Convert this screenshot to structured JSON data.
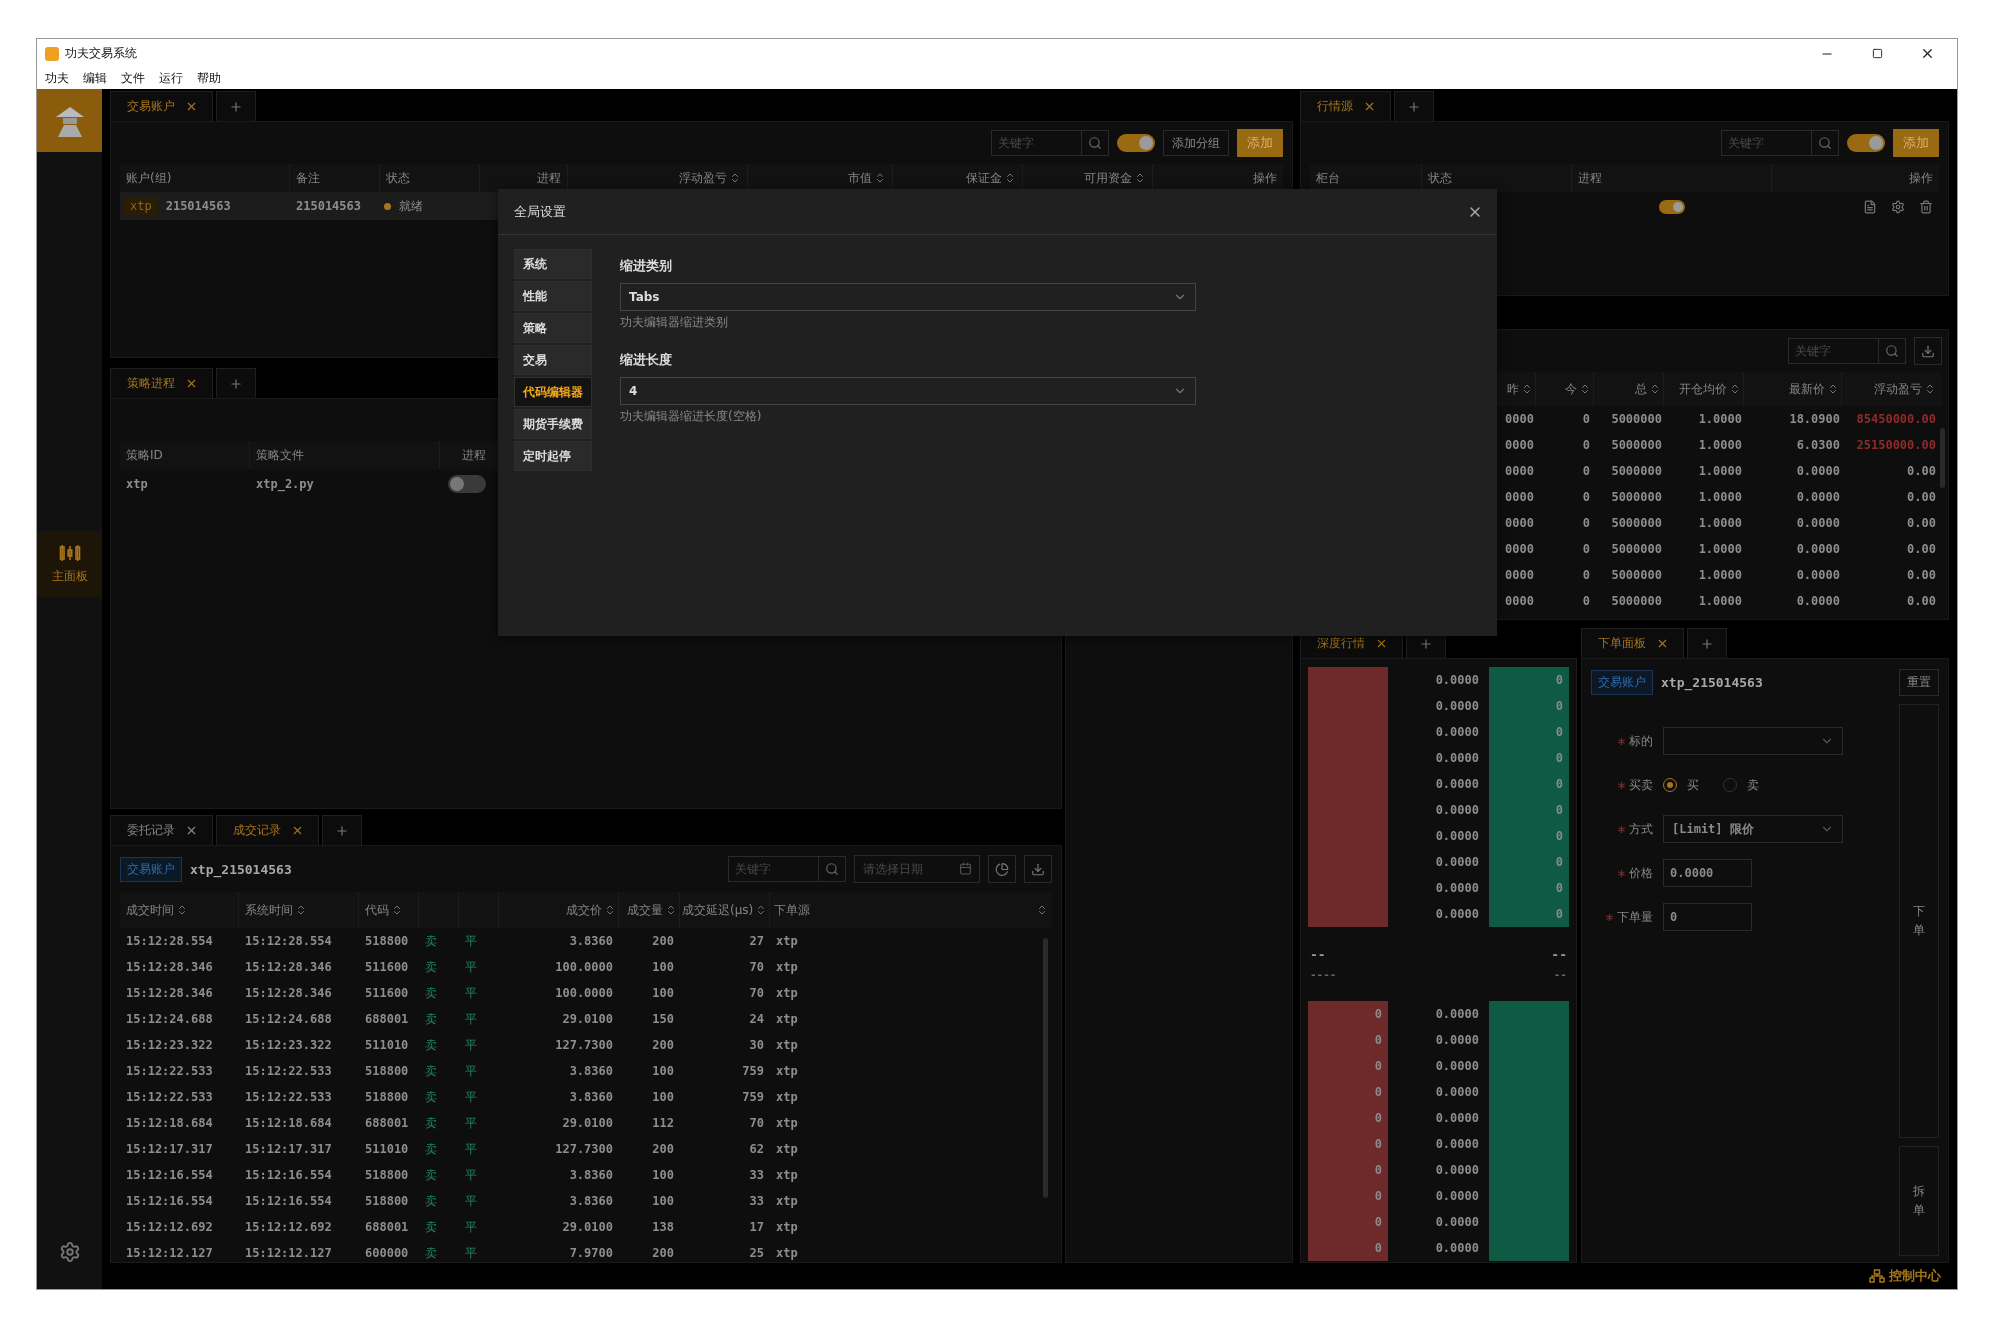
{
  "window": {
    "title": "功夫交易系统"
  },
  "menu": [
    "功夫",
    "编辑",
    "文件",
    "运行",
    "帮助"
  ],
  "sidebar": {
    "items": [
      {
        "label": "主面板",
        "selected": true
      }
    ]
  },
  "accounts_panel": {
    "tabs": [
      {
        "label": "交易账户",
        "selected": true
      }
    ],
    "search": {
      "placeholder": "关键字"
    },
    "toggle_on": true,
    "buttons": [
      "添加分组",
      "添加"
    ],
    "columns": [
      {
        "label": "账户(组)",
        "sortable": false
      },
      {
        "label": "备注",
        "sortable": false
      },
      {
        "label": "状态",
        "sortable": false
      },
      {
        "label": "进程",
        "sortable": false
      },
      {
        "label": "浮动盈亏",
        "sortable": true
      },
      {
        "label": "市值",
        "sortable": true
      },
      {
        "label": "保证金",
        "sortable": true
      },
      {
        "label": "可用资金",
        "sortable": true
      },
      {
        "label": "操作",
        "sortable": false
      }
    ],
    "rows": [
      {
        "source": "xtp",
        "account": "215014563",
        "note": "215014563",
        "status": "就绪",
        "color": "#a8761a",
        "selected": true
      }
    ]
  },
  "strategy_panel": {
    "tabs": [
      {
        "label": "策略进程",
        "selected": true
      }
    ],
    "columns": [
      "策略ID",
      "策略文件",
      "进程"
    ],
    "rows": [
      {
        "id": "xtp",
        "file": "xtp_2.py",
        "running": false
      }
    ]
  },
  "trades_panel": {
    "tabs": [
      {
        "label": "委托记录",
        "selected": false
      },
      {
        "label": "成交记录",
        "selected": true
      }
    ],
    "account_tag": "交易账户",
    "account": "xtp_215014563",
    "search": {
      "placeholder": "关键字"
    },
    "date": {
      "placeholder": "请选择日期"
    },
    "columns": [
      {
        "label": "成交时间",
        "sortable": true
      },
      {
        "label": "系统时间",
        "sortable": true
      },
      {
        "label": "代码",
        "sortable": true
      },
      {
        "label": "成交价",
        "sortable": true
      },
      {
        "label": "成交量",
        "sortable": true
      },
      {
        "label": "成交延迟(μs)",
        "sortable": true
      },
      {
        "label": "下单源",
        "sortable": true
      }
    ],
    "rows": [
      {
        "trade_time": "15:12:28.554",
        "system_time": "15:12:28.554",
        "code": "518800",
        "side": "卖",
        "offset": "平",
        "price": "3.8360",
        "volume": "200",
        "latency": "27",
        "source": "xtp"
      },
      {
        "trade_time": "15:12:28.346",
        "system_time": "15:12:28.346",
        "code": "511600",
        "side": "卖",
        "offset": "平",
        "price": "100.0000",
        "volume": "100",
        "latency": "70",
        "source": "xtp"
      },
      {
        "trade_time": "15:12:28.346",
        "system_time": "15:12:28.346",
        "code": "511600",
        "side": "卖",
        "offset": "平",
        "price": "100.0000",
        "volume": "100",
        "latency": "70",
        "source": "xtp"
      },
      {
        "trade_time": "15:12:24.688",
        "system_time": "15:12:24.688",
        "code": "688001",
        "side": "卖",
        "offset": "平",
        "price": "29.0100",
        "volume": "150",
        "latency": "24",
        "source": "xtp"
      },
      {
        "trade_time": "15:12:23.322",
        "system_time": "15:12:23.322",
        "code": "511010",
        "side": "卖",
        "offset": "平",
        "price": "127.7300",
        "volume": "200",
        "latency": "30",
        "source": "xtp"
      },
      {
        "trade_time": "15:12:22.533",
        "system_time": "15:12:22.533",
        "code": "518800",
        "side": "卖",
        "offset": "平",
        "price": "3.8360",
        "volume": "100",
        "latency": "759",
        "source": "xtp"
      },
      {
        "trade_time": "15:12:22.533",
        "system_time": "15:12:22.533",
        "code": "518800",
        "side": "卖",
        "offset": "平",
        "price": "3.8360",
        "volume": "100",
        "latency": "759",
        "source": "xtp"
      },
      {
        "trade_time": "15:12:18.684",
        "system_time": "15:12:18.684",
        "code": "688001",
        "side": "卖",
        "offset": "平",
        "price": "29.0100",
        "volume": "112",
        "latency": "70",
        "source": "xtp"
      },
      {
        "trade_time": "15:12:17.317",
        "system_time": "15:12:17.317",
        "code": "511010",
        "side": "卖",
        "offset": "平",
        "price": "127.7300",
        "volume": "200",
        "latency": "62",
        "source": "xtp"
      },
      {
        "trade_time": "15:12:16.554",
        "system_time": "15:12:16.554",
        "code": "518800",
        "side": "卖",
        "offset": "平",
        "price": "3.8360",
        "volume": "100",
        "latency": "33",
        "source": "xtp"
      },
      {
        "trade_time": "15:12:16.554",
        "system_time": "15:12:16.554",
        "code": "518800",
        "side": "卖",
        "offset": "平",
        "price": "3.8360",
        "volume": "100",
        "latency": "33",
        "source": "xtp"
      },
      {
        "trade_time": "15:12:12.692",
        "system_time": "15:12:12.692",
        "code": "688001",
        "side": "卖",
        "offset": "平",
        "price": "29.0100",
        "volume": "138",
        "latency": "17",
        "source": "xtp"
      },
      {
        "trade_time": "15:12:12.127",
        "system_time": "15:12:12.127",
        "code": "600000",
        "side": "卖",
        "offset": "平",
        "price": "7.9700",
        "volume": "200",
        "latency": "25",
        "source": "xtp"
      }
    ]
  },
  "feed_panel": {
    "tabs": [
      {
        "label": "行情源",
        "selected": true
      }
    ],
    "search": {
      "placeholder": "关键字"
    },
    "toggle_on": true,
    "button": "添加",
    "columns": [
      "柜台",
      "状态",
      "进程",
      "操作"
    ],
    "rows": [
      {
        "running": true
      }
    ]
  },
  "positions_panel": {
    "search": {
      "placeholder": "关键字"
    },
    "columns": [
      "昨",
      "今",
      "总",
      "开仓均价",
      "最新价",
      "浮动盈亏"
    ],
    "rows": [
      {
        "yesterday": "0000",
        "today": "0",
        "total": "5000000",
        "avg_price": "1.0000",
        "last_price": "18.0900",
        "pnl": "85450000.00",
        "gain": true
      },
      {
        "yesterday": "0000",
        "today": "0",
        "total": "5000000",
        "avg_price": "1.0000",
        "last_price": "6.0300",
        "pnl": "25150000.00",
        "gain": true
      },
      {
        "yesterday": "0000",
        "today": "0",
        "total": "5000000",
        "avg_price": "1.0000",
        "last_price": "0.0000",
        "pnl": "0.00",
        "gain": false
      },
      {
        "yesterday": "0000",
        "today": "0",
        "total": "5000000",
        "avg_price": "1.0000",
        "last_price": "0.0000",
        "pnl": "0.00",
        "gain": false
      },
      {
        "yesterday": "0000",
        "today": "0",
        "total": "5000000",
        "avg_price": "1.0000",
        "last_price": "0.0000",
        "pnl": "0.00",
        "gain": false
      },
      {
        "yesterday": "0000",
        "today": "0",
        "total": "5000000",
        "avg_price": "1.0000",
        "last_price": "0.0000",
        "pnl": "0.00",
        "gain": false
      },
      {
        "yesterday": "0000",
        "today": "0",
        "total": "5000000",
        "avg_price": "1.0000",
        "last_price": "0.0000",
        "pnl": "0.00",
        "gain": false
      },
      {
        "yesterday": "0000",
        "today": "0",
        "total": "5000000",
        "avg_price": "1.0000",
        "last_price": "0.0000",
        "pnl": "0.00",
        "gain": false
      }
    ]
  },
  "depth_panel": {
    "tabs": [
      {
        "label": "深度行情",
        "selected": true
      }
    ],
    "asks": [
      {
        "price": "0.0000",
        "volume": "0"
      },
      {
        "price": "0.0000",
        "volume": "0"
      },
      {
        "price": "0.0000",
        "volume": "0"
      },
      {
        "price": "0.0000",
        "volume": "0"
      },
      {
        "price": "0.0000",
        "volume": "0"
      },
      {
        "price": "0.0000",
        "volume": "0"
      },
      {
        "price": "0.0000",
        "volume": "0"
      },
      {
        "price": "0.0000",
        "volume": "0"
      },
      {
        "price": "0.0000",
        "volume": "0"
      },
      {
        "price": "0.0000",
        "volume": "0"
      }
    ],
    "middle": [
      "--",
      "--",
      "----",
      "--"
    ],
    "bids": [
      {
        "price": "0.0000",
        "volume": "0"
      },
      {
        "price": "0.0000",
        "volume": "0"
      },
      {
        "price": "0.0000",
        "volume": "0"
      },
      {
        "price": "0.0000",
        "volume": "0"
      },
      {
        "price": "0.0000",
        "volume": "0"
      },
      {
        "price": "0.0000",
        "volume": "0"
      },
      {
        "price": "0.0000",
        "volume": "0"
      },
      {
        "price": "0.0000",
        "volume": "0"
      },
      {
        "price": "0.0000",
        "volume": "0"
      },
      {
        "price": "0.0000",
        "volume": "0"
      }
    ]
  },
  "order_panel": {
    "tabs": [
      {
        "label": "下单面板",
        "selected": true
      }
    ],
    "account_tag": "交易账户",
    "account": "xtp_215014563",
    "reset": "重置",
    "fields": [
      {
        "kind": "select",
        "label": "标的",
        "required": true
      },
      {
        "kind": "radio",
        "label": "买卖",
        "required": true,
        "options": [
          {
            "label": "买",
            "selected": true
          },
          {
            "label": "卖",
            "selected": false
          }
        ]
      },
      {
        "kind": "select",
        "label": "方式",
        "required": true,
        "value": "[Limit] 限价"
      },
      {
        "kind": "input",
        "label": "价格",
        "required": true,
        "value": "0.0000"
      },
      {
        "kind": "input",
        "label": "下单量",
        "required": true,
        "value": "0"
      }
    ],
    "buttons": [
      "下单",
      "拆单"
    ]
  },
  "status_bar": {
    "label": "控制中心"
  },
  "modal": {
    "title": "全局设置",
    "nav": [
      {
        "label": "系统",
        "selected": false
      },
      {
        "label": "性能",
        "selected": false
      },
      {
        "label": "策略",
        "selected": false
      },
      {
        "label": "交易",
        "selected": false
      },
      {
        "label": "代码编辑器",
        "selected": true
      },
      {
        "label": "期货手续费",
        "selected": false
      },
      {
        "label": "定时起停",
        "selected": false
      }
    ],
    "fields": [
      {
        "label": "缩进类别",
        "value": "Tabs",
        "hint": "功夫编辑器缩进类别"
      },
      {
        "label": "缩进长度",
        "value": "4",
        "hint": "功夫编辑器缩进长度(空格)"
      }
    ]
  }
}
